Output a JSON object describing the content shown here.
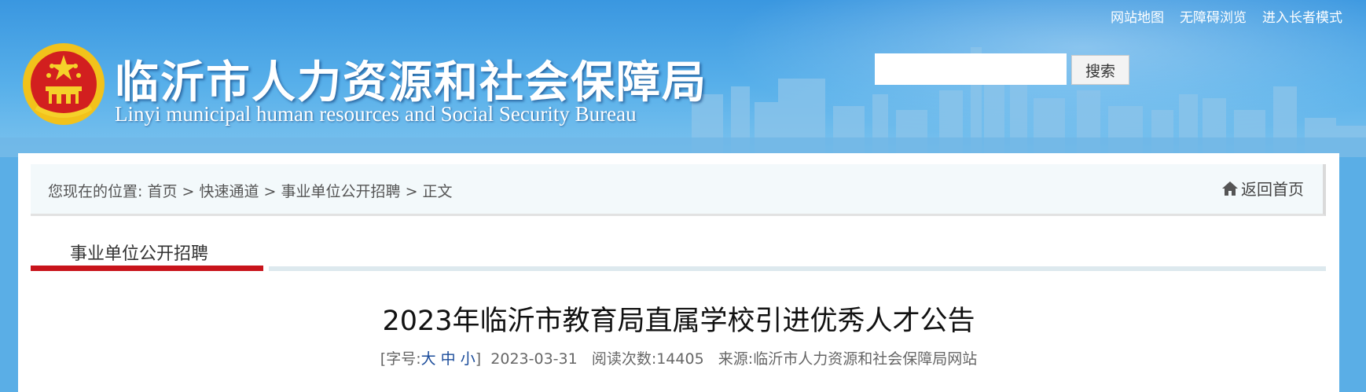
{
  "header": {
    "title": "临沂市人力资源和社会保障局",
    "subtitle": "Linyi municipal human resources and Social Security Bureau",
    "top_links": [
      "网站地图",
      "无障碍浏览",
      "进入长者模式"
    ],
    "search": {
      "placeholder": "",
      "button_label": "搜索"
    }
  },
  "breadcrumb": {
    "prefix": "您现在的位置:",
    "items": [
      "首页",
      "快速通道",
      "事业单位公开招聘",
      "正文"
    ],
    "separator": ">",
    "home_link": "返回首页"
  },
  "section_tab": {
    "label": "事业单位公开招聘",
    "accent_color": "#c8141b"
  },
  "article": {
    "title": "2023年临沂市教育局直属学校引进优秀人才公告",
    "meta": {
      "font_size_label_open": "[字号:",
      "font_sizes": [
        "大",
        "中",
        "小"
      ],
      "font_size_label_close": "]",
      "date": "2023-03-31",
      "views_label": "阅读次数:",
      "views": "14405",
      "source_label": "来源:",
      "source": "临沂市人力资源和社会保障局网站"
    }
  },
  "icons": {
    "emblem": "national-emblem-icon",
    "home": "home-icon"
  }
}
